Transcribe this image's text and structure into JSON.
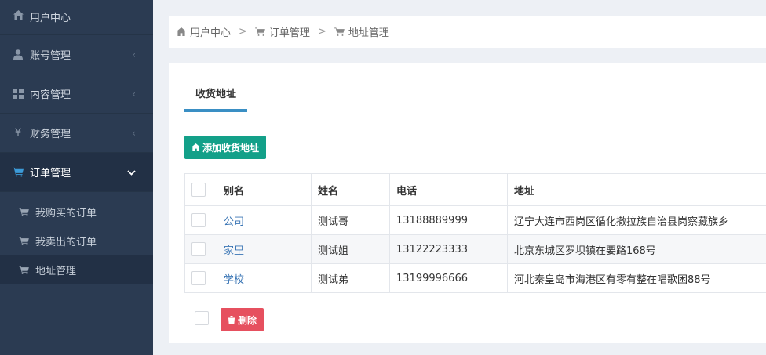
{
  "sidebar": {
    "items": [
      {
        "label": "用户中心",
        "icon": "home-icon"
      },
      {
        "label": "账号管理",
        "icon": "user-icon"
      },
      {
        "label": "内容管理",
        "icon": "grid-icon"
      },
      {
        "label": "财务管理",
        "icon": "yen-icon"
      },
      {
        "label": "订单管理",
        "icon": "cart-icon"
      }
    ],
    "submenu": [
      {
        "label": "我购买的订单"
      },
      {
        "label": "我卖出的订单"
      },
      {
        "label": "地址管理"
      }
    ]
  },
  "breadcrumb": {
    "items": [
      "用户中心",
      "订单管理",
      "地址管理"
    ],
    "separator": ">"
  },
  "tabs": [
    {
      "label": "收货地址"
    }
  ],
  "actions": {
    "add_label": "添加收货地址",
    "delete_label": "删除"
  },
  "table": {
    "headers": [
      "别名",
      "姓名",
      "电话",
      "地址"
    ],
    "rows": [
      {
        "alias": "公司",
        "name": "测试哥",
        "phone": "13188889999",
        "address": "辽宁大连市西岗区循化撒拉族自治县岗察藏族乡"
      },
      {
        "alias": "家里",
        "name": "测试姐",
        "phone": "13122223333",
        "address": "北京东城区罗坝镇在要路168号"
      },
      {
        "alias": "学校",
        "name": "测试弟",
        "phone": "13199996666",
        "address": "河北秦皇岛市海港区有零有整在唱歌困88号"
      }
    ]
  },
  "colors": {
    "sidebar_bg": "#2b3b52",
    "accent_blue": "#3a8fc4",
    "add_button": "#13a089",
    "delete_button": "#e6505f",
    "link": "#3b76b5"
  }
}
